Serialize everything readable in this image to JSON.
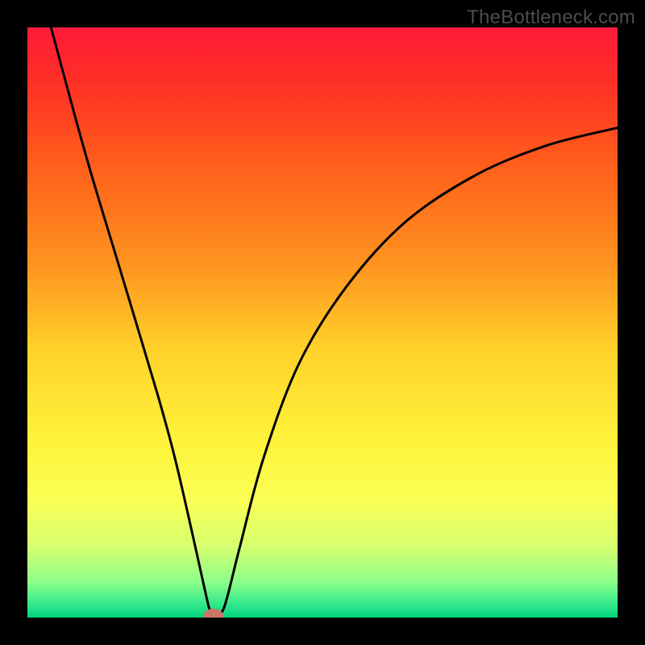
{
  "watermark": "TheBottleneck.com",
  "chart_data": {
    "type": "line",
    "title": "",
    "xlabel": "",
    "ylabel": "",
    "xlim": [
      0,
      100
    ],
    "ylim": [
      0,
      100
    ],
    "background": {
      "stops": [
        {
          "offset": 0.0,
          "color": "#ff1a3a"
        },
        {
          "offset": 0.08,
          "color": "#ff2c28"
        },
        {
          "offset": 0.22,
          "color": "#ff5a1b"
        },
        {
          "offset": 0.4,
          "color": "#ff931f"
        },
        {
          "offset": 0.55,
          "color": "#ffd32a"
        },
        {
          "offset": 0.7,
          "color": "#fff23a"
        },
        {
          "offset": 0.8,
          "color": "#faff55"
        },
        {
          "offset": 0.88,
          "color": "#d6ff70"
        },
        {
          "offset": 0.94,
          "color": "#8cff8a"
        },
        {
          "offset": 0.98,
          "color": "#2ce68a"
        },
        {
          "offset": 1.0,
          "color": "#00d47c"
        }
      ]
    },
    "curve": {
      "stroke": "#000000",
      "width": 3,
      "points": [
        {
          "x": 4,
          "y": 100
        },
        {
          "x": 10,
          "y": 78
        },
        {
          "x": 16,
          "y": 58
        },
        {
          "x": 22,
          "y": 38
        },
        {
          "x": 25,
          "y": 27
        },
        {
          "x": 28,
          "y": 14
        },
        {
          "x": 30,
          "y": 5
        },
        {
          "x": 31,
          "y": 1
        },
        {
          "x": 32,
          "y": 0.5
        },
        {
          "x": 33,
          "y": 1
        },
        {
          "x": 34,
          "y": 4
        },
        {
          "x": 36,
          "y": 12
        },
        {
          "x": 40,
          "y": 27
        },
        {
          "x": 46,
          "y": 43
        },
        {
          "x": 54,
          "y": 56
        },
        {
          "x": 64,
          "y": 67
        },
        {
          "x": 76,
          "y": 75
        },
        {
          "x": 88,
          "y": 80
        },
        {
          "x": 100,
          "y": 83
        }
      ]
    },
    "marker": {
      "x": 31.5,
      "y": 0.3,
      "rx": 1.7,
      "ry": 1.2,
      "fill": "#cc7766"
    }
  }
}
